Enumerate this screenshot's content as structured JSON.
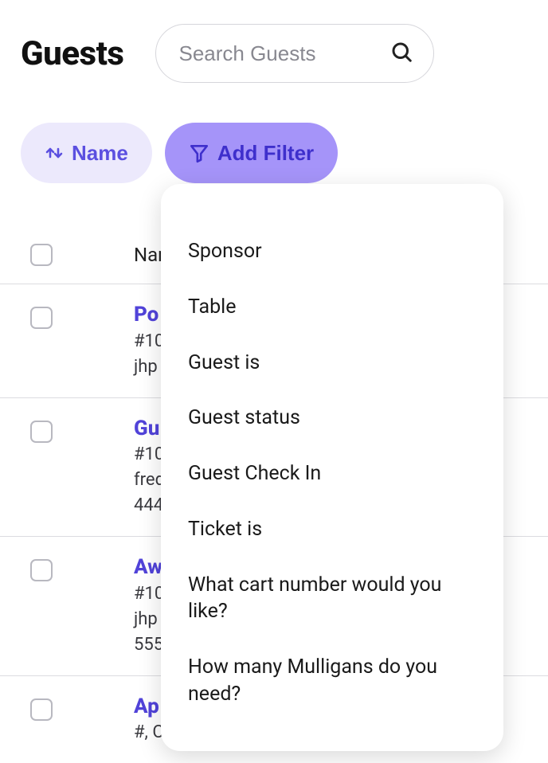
{
  "page": {
    "title": "Guests"
  },
  "search": {
    "placeholder": "Search Guests",
    "value": ""
  },
  "sort": {
    "label": "Name"
  },
  "filter": {
    "add_label": "Add Filter",
    "options": [
      "Sponsor",
      "Table",
      "Guest is",
      "Guest status",
      "Guest Check In",
      "Ticket is",
      "What cart number would you like?",
      "How many Mulligans do you need?"
    ]
  },
  "table": {
    "columns": {
      "name": "Name"
    },
    "rows": [
      {
        "name": "Po",
        "line2": "#10",
        "line3": "jhp"
      },
      {
        "name": "Gu",
        "line2": "#10",
        "line3": "fred",
        "line4": "444"
      },
      {
        "name": "Aw",
        "line2": "#10",
        "line3": "jhp",
        "line4": "555"
      },
      {
        "name": "Ap",
        "line2": "#, Checked-in, IsNotBidder"
      }
    ]
  }
}
